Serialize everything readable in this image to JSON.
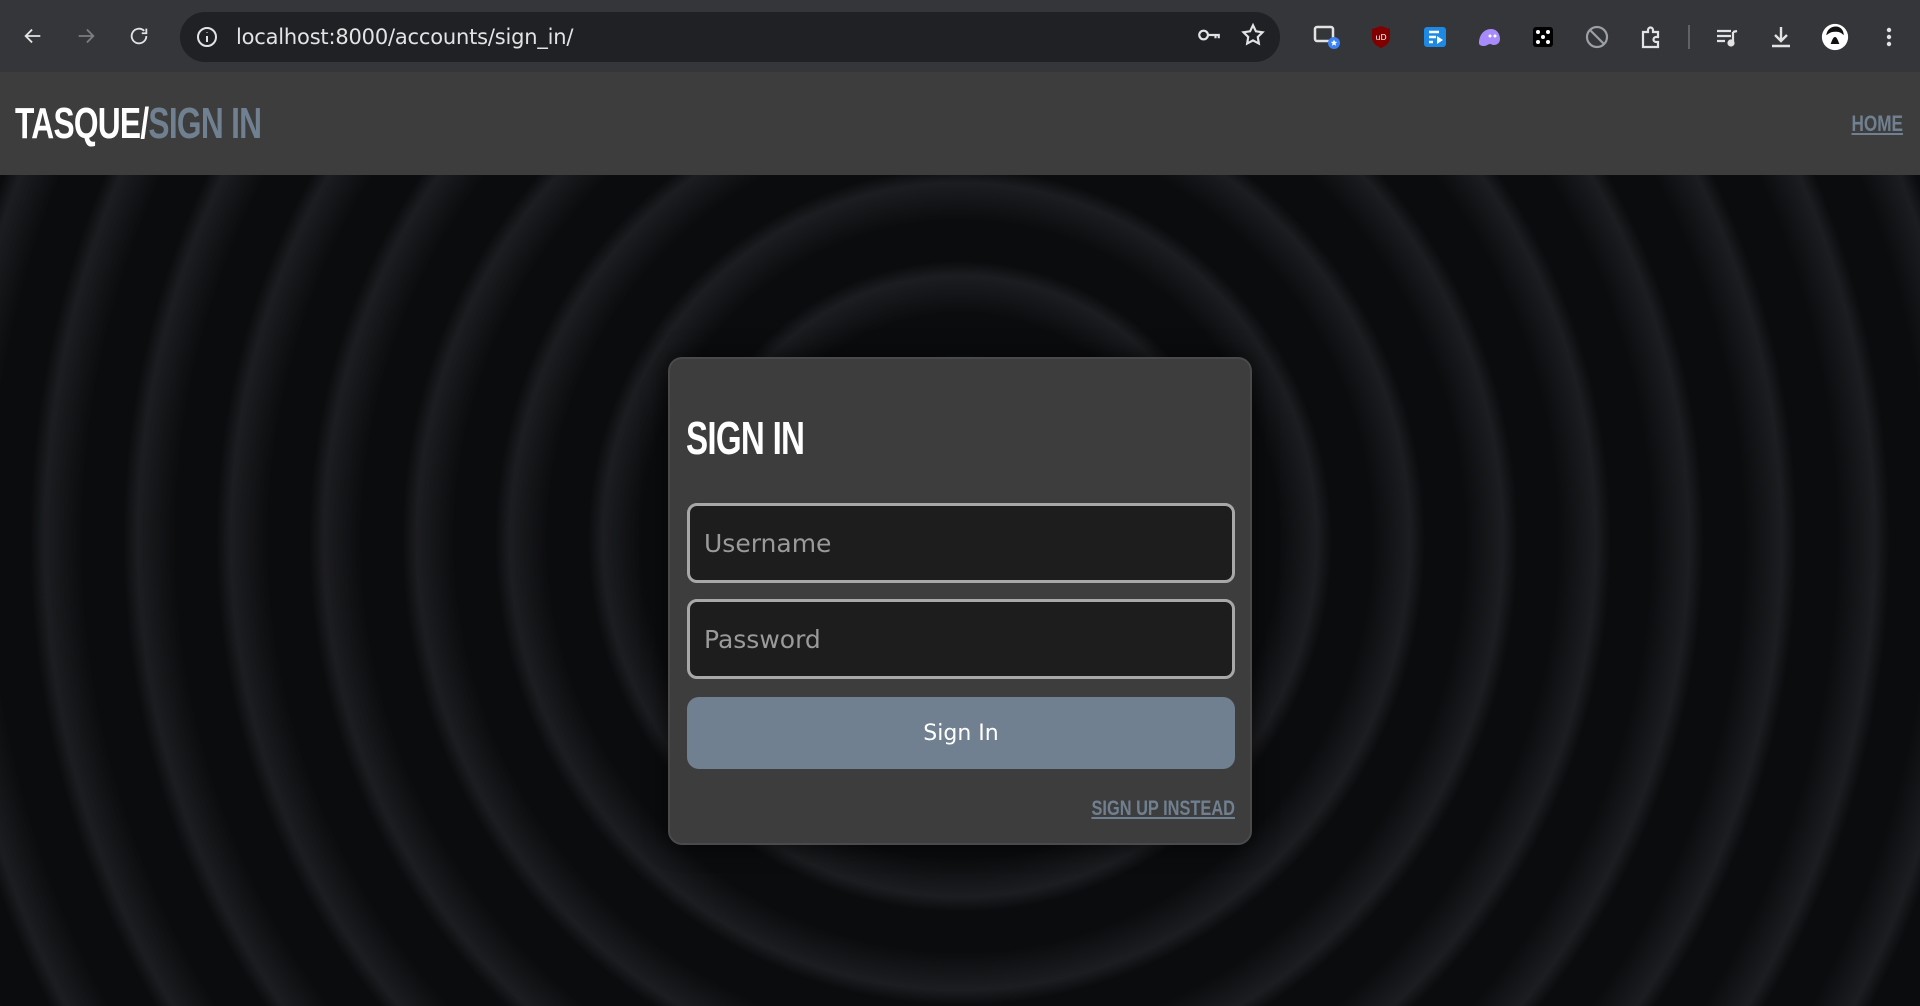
{
  "browser": {
    "url": "localhost:8000/accounts/sign_in/",
    "nav_icons": [
      "back-arrow-icon",
      "forward-arrow-icon",
      "reload-icon"
    ],
    "omnibox_icons": [
      "site-info-icon",
      "password-key-icon",
      "bookmark-star-icon"
    ],
    "extension_icons": [
      "screen-cast-icon",
      "ublock-origin-icon",
      "flash-extension-icon",
      "ghost-extension-icon",
      "dice-extension-icon",
      "blocked-icon",
      "extensions-puzzle-icon",
      "media-playlist-icon",
      "downloads-icon",
      "profile-avatar-icon",
      "more-menu-icon"
    ]
  },
  "site": {
    "brand_primary": "TASQUE/",
    "brand_secondary": "SIGN IN",
    "home_link": "HOME"
  },
  "form": {
    "title": "SIGN IN",
    "username_placeholder": "Username",
    "password_placeholder": "Password",
    "submit_label": "Sign In",
    "alt_link": "SIGN UP INSTEAD"
  },
  "colors": {
    "accent": "#708090",
    "header_bg": "#3d3d3d",
    "page_bg": "#0b0c0e",
    "card_bg": "#3d3d3d"
  }
}
